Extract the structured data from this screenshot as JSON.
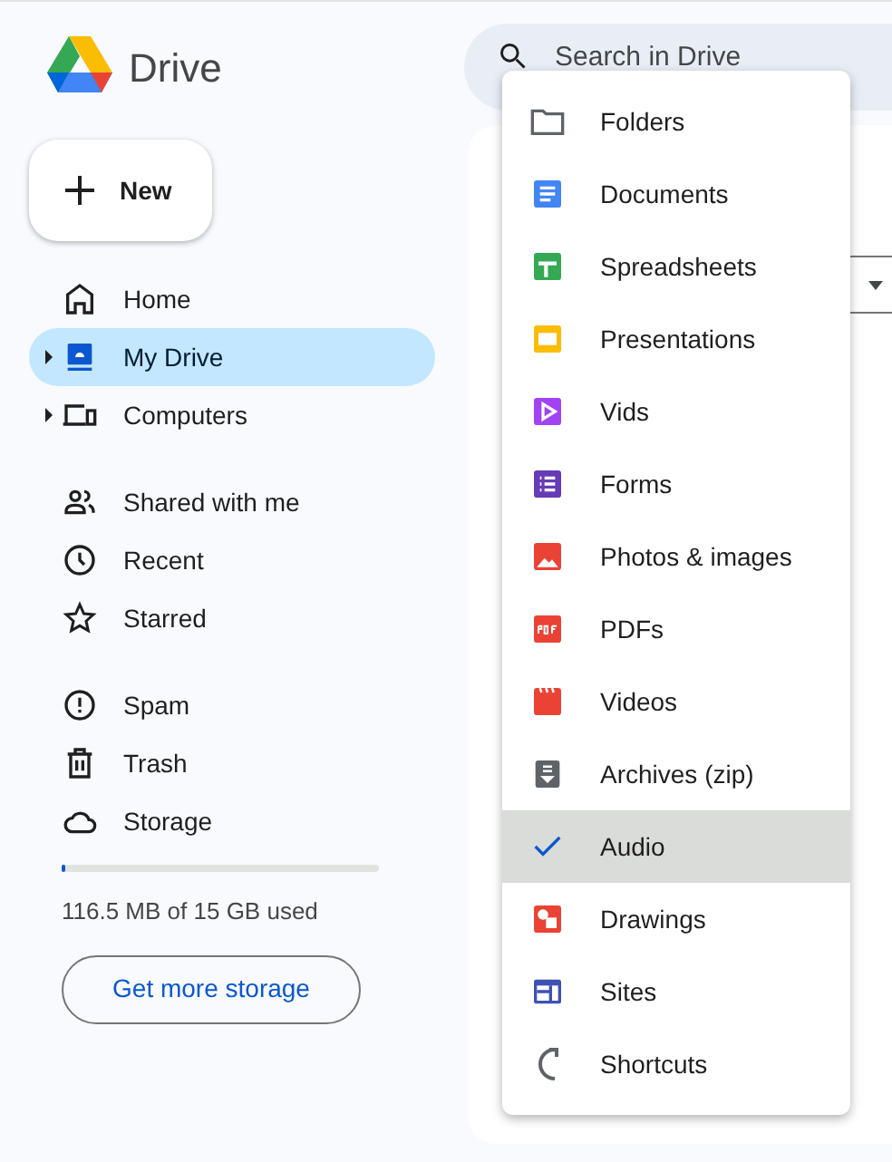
{
  "app": {
    "title": "Drive"
  },
  "new_button": {
    "label": "New"
  },
  "sidebar": {
    "groups": [
      [
        {
          "label": "Home",
          "kind": "home",
          "selected": false,
          "expandable": false
        },
        {
          "label": "My Drive",
          "kind": "drive",
          "selected": true,
          "expandable": true
        },
        {
          "label": "Computers",
          "kind": "computer",
          "selected": false,
          "expandable": true
        }
      ],
      [
        {
          "label": "Shared with me",
          "kind": "people",
          "selected": false,
          "expandable": false
        },
        {
          "label": "Recent",
          "kind": "clock",
          "selected": false,
          "expandable": false
        },
        {
          "label": "Starred",
          "kind": "star",
          "selected": false,
          "expandable": false
        }
      ],
      [
        {
          "label": "Spam",
          "kind": "spam",
          "selected": false,
          "expandable": false
        },
        {
          "label": "Trash",
          "kind": "trash",
          "selected": false,
          "expandable": false
        },
        {
          "label": "Storage",
          "kind": "cloud",
          "selected": false,
          "expandable": false
        }
      ]
    ]
  },
  "storage": {
    "level": 0.01,
    "usage": "116.5 MB of 15 GB used",
    "button": "Get more storage"
  },
  "search": {
    "placeholder": "Search in Drive"
  },
  "type_menu": {
    "items": [
      {
        "label": "Folders",
        "kind": "folder",
        "selected": false
      },
      {
        "label": "Documents",
        "kind": "docs",
        "selected": false
      },
      {
        "label": "Spreadsheets",
        "kind": "sheets",
        "selected": false
      },
      {
        "label": "Presentations",
        "kind": "slides",
        "selected": false
      },
      {
        "label": "Vids",
        "kind": "vids",
        "selected": false
      },
      {
        "label": "Forms",
        "kind": "forms",
        "selected": false
      },
      {
        "label": "Photos & images",
        "kind": "photos",
        "selected": false
      },
      {
        "label": "PDFs",
        "kind": "pdf",
        "selected": false
      },
      {
        "label": "Videos",
        "kind": "videos",
        "selected": false
      },
      {
        "label": "Archives (zip)",
        "kind": "zip",
        "selected": false
      },
      {
        "label": "Audio",
        "kind": "audio",
        "selected": true
      },
      {
        "label": "Drawings",
        "kind": "drawings",
        "selected": false
      },
      {
        "label": "Sites",
        "kind": "sites",
        "selected": false
      },
      {
        "label": "Shortcuts",
        "kind": "shortcut",
        "selected": false
      }
    ]
  }
}
